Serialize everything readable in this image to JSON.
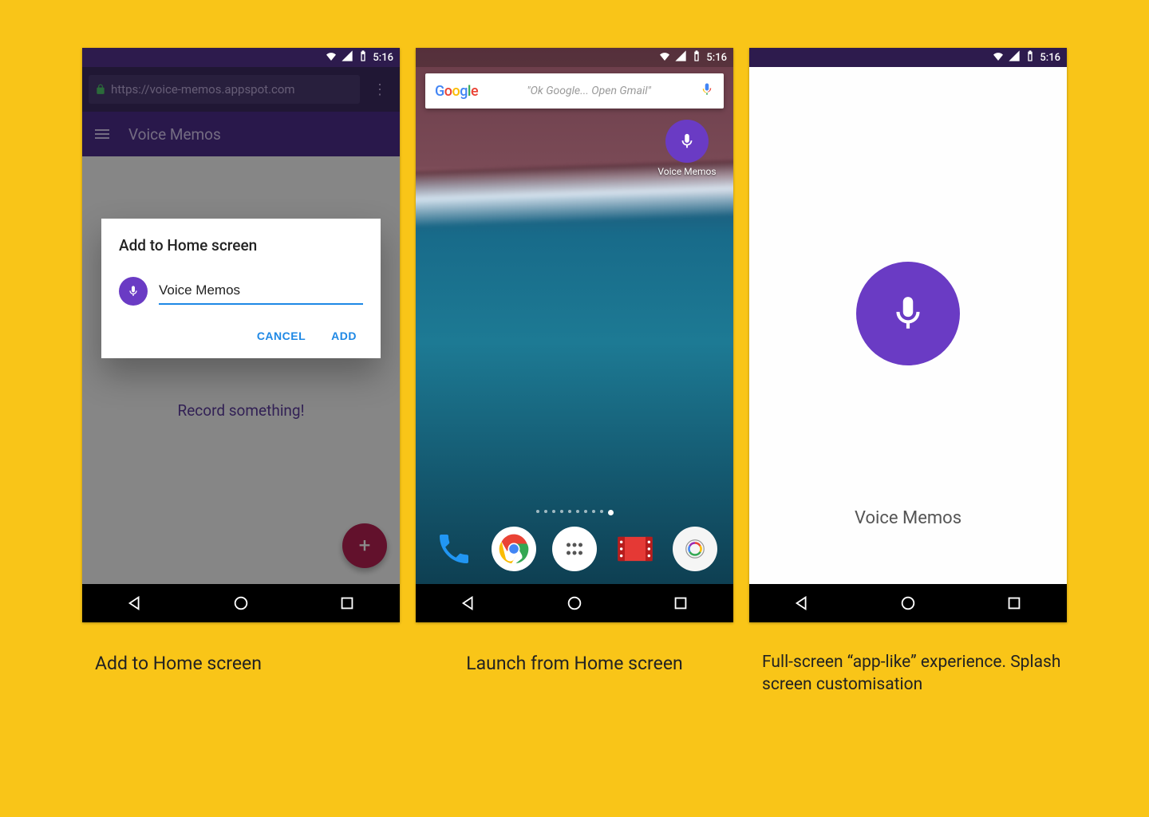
{
  "status": {
    "time": "5:16"
  },
  "phone1": {
    "url": "https://voice-memos.appspot.com",
    "app_title": "Voice Memos",
    "record_prompt": "Record something!",
    "dialog": {
      "title": "Add to Home screen",
      "input_value": "Voice Memos",
      "cancel": "CANCEL",
      "add": "ADD"
    },
    "caption": "Add to Home screen"
  },
  "phone2": {
    "search_hint": "\"Ok Google... Open Gmail\"",
    "shortcut_label": "Voice Memos",
    "caption": "Launch from Home screen"
  },
  "phone3": {
    "app_name": "Voice Memos",
    "caption": "Full-screen “app-like” experience. Splash screen customisation"
  },
  "colors": {
    "accent_purple": "#6a3bc4",
    "toolbar_purple": "#4c2d89",
    "status_purple": "#2d1b4d",
    "fab_pink": "#b22050",
    "link_blue": "#1e88e5"
  }
}
